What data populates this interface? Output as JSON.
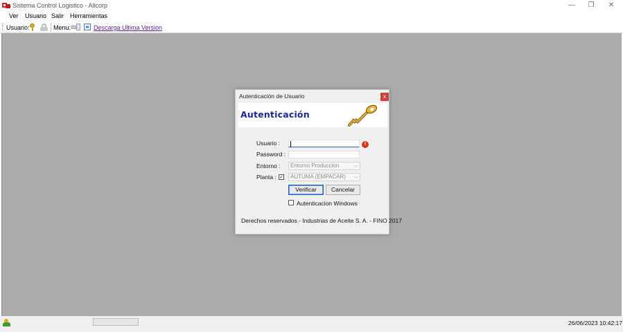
{
  "window": {
    "title": "Sistema Control Logistico - Alicorp",
    "minimize": "—",
    "maximize": "❐",
    "close": "✕"
  },
  "menu": {
    "items": [
      {
        "label": "Ver"
      },
      {
        "label": "Usuario"
      },
      {
        "label": "Salir"
      },
      {
        "label": "Herramientas"
      }
    ]
  },
  "toolbar": {
    "usuario_label": "Usuario:",
    "menu_label": "Menu:",
    "download_link": "Descarga Ultima Version",
    "icons": [
      "key-icon",
      "lock-icon",
      "menu-icon",
      "download-icon"
    ]
  },
  "dialog": {
    "title": "Autenticación de Usuario",
    "close": "x",
    "heading": "Autenticación",
    "usuario_label": "Usuario :",
    "usuario_value": "",
    "password_label": "Password :",
    "password_value": "",
    "entorno_label": "Entorno :",
    "entorno_value": "Entorno Produccion",
    "planta_label": "Planta :",
    "planta_checked": true,
    "planta_value": "AUTUMA (EMPACAR)",
    "verify_button": "Verificar",
    "cancel_button": "Cancelar",
    "windows_auth_label": "Autenticacion Windows",
    "windows_auth_checked": false,
    "footer": "Derechos reservados - Industrias de Aceite S. A. - FINO 2017",
    "error_glyph": "!"
  },
  "statusbar": {
    "datetime": "26/06/2023 10:42:17"
  },
  "colors": {
    "mdi_background": "#ababab",
    "heading": "#1428a8",
    "link": "#5a1ea6",
    "close_button": "#c94340"
  }
}
